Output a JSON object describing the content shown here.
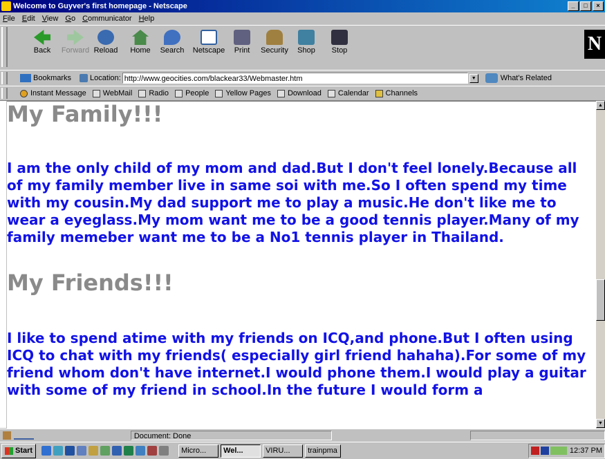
{
  "window": {
    "title": "Welcome to Guyver's first homepage - Netscape"
  },
  "menu": [
    "File",
    "Edit",
    "View",
    "Go",
    "Communicator",
    "Help"
  ],
  "toolbar": {
    "buttons": [
      {
        "label": "Back",
        "icon": "back-arrow-icon",
        "color": "#2a9a2a"
      },
      {
        "label": "Forward",
        "icon": "forward-arrow-icon",
        "color": "#9fc79f"
      },
      {
        "label": "Reload",
        "icon": "reload-icon",
        "color": "#3a6ab0"
      },
      {
        "label": "Home",
        "icon": "home-icon",
        "color": "#4a8a4a"
      },
      {
        "label": "Search",
        "icon": "search-icon",
        "color": "#4070c0"
      },
      {
        "label": "Netscape",
        "icon": "netscape-icon",
        "color": "#3060a0"
      },
      {
        "label": "Print",
        "icon": "print-icon",
        "color": "#606080"
      },
      {
        "label": "Security",
        "icon": "lock-icon",
        "color": "#a08040"
      },
      {
        "label": "Shop",
        "icon": "shop-icon",
        "color": "#4080a0"
      },
      {
        "label": "Stop",
        "icon": "stop-icon",
        "color": "#303040"
      }
    ],
    "logo": "N"
  },
  "location": {
    "bookmarks_label": "Bookmarks",
    "location_label": "Location:",
    "url": "http://www.geocities.com/blackear33/Webmaster.htm",
    "whats_related": "What's Related"
  },
  "personal_toolbar": [
    "Instant Message",
    "WebMail",
    "Radio",
    "People",
    "Yellow Pages",
    "Download",
    "Calendar",
    "Channels"
  ],
  "page": {
    "heading1": "My Family!!!",
    "para1": "I am the only child of my mom and dad.But I don't feel lonely.Because all of my family member live in same soi with me.So I often spend my time with my cousin.My dad support me to play a music.He don't like me to wear a eyeglass.My mom want me to be a good tennis player.Many of my family memeber want me to be a No1 tennis player in Thailand.",
    "heading2": "My Friends!!!",
    "para2": "I like to spend atime with my friends on ICQ,and phone.But I often using ICQ to chat with my friends( especially girl friend hahaha).For some of my friend whom don't have internet.I would phone them.I would play a guitar with some of my friend in school.In the future I would form a"
  },
  "status": {
    "text": "Document: Done"
  },
  "taskbar": {
    "start": "Start",
    "tasks": [
      "Micro...",
      "Wel...",
      "VIRU...",
      "trainpma"
    ],
    "clock": "12:37 PM"
  }
}
